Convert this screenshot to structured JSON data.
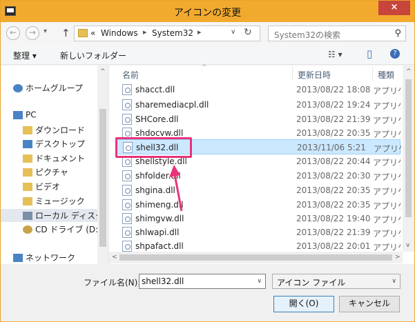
{
  "window": {
    "title": "アイコンの変更",
    "close_glyph": "×"
  },
  "nav": {
    "back_glyph": "←",
    "forward_glyph": "→",
    "history_glyph": "▾",
    "up_glyph": "↑",
    "crumbs": [
      "«",
      "Windows",
      "▸",
      "System32",
      "▸"
    ],
    "dropdown_glyph": "∨",
    "refresh_glyph": "↻",
    "search_placeholder": "System32の検索",
    "search_glyph": "⚲"
  },
  "toolbar": {
    "organize_label": "整理 ▾",
    "new_folder_label": "新しいフォルダー",
    "view_glyph": "☷ ▾",
    "pane_glyph": "▯",
    "help_glyph": "?"
  },
  "sidebar": {
    "items": [
      {
        "label": "ホームグループ",
        "icon": "homegroup-icon",
        "color": "#4a83c5"
      },
      {
        "label": "PC",
        "icon": "pc-icon",
        "color": "#4a83c5"
      },
      {
        "label": "ダウンロード",
        "icon": "downloads-folder-icon",
        "color": "#e6bf57"
      },
      {
        "label": "デスクトップ",
        "icon": "desktop-folder-icon",
        "color": "#4a83c5"
      },
      {
        "label": "ドキュメント",
        "icon": "documents-folder-icon",
        "color": "#e6bf57"
      },
      {
        "label": "ピクチャ",
        "icon": "pictures-folder-icon",
        "color": "#e6bf57"
      },
      {
        "label": "ビデオ",
        "icon": "videos-folder-icon",
        "color": "#e6bf57"
      },
      {
        "label": "ミュージック",
        "icon": "music-folder-icon",
        "color": "#e6bf57"
      },
      {
        "label": "ローカル ディスク (C",
        "icon": "local-disk-icon",
        "color": "#7a8fa8"
      },
      {
        "label": "CD ドライブ (D:) \\",
        "icon": "cd-drive-icon",
        "color": "#c9a34a"
      },
      {
        "label": "ネットワーク",
        "icon": "network-icon",
        "color": "#4a83c5"
      }
    ]
  },
  "columns": {
    "name": "名前",
    "date": "更新日時",
    "type": "種類",
    "sort_glyph": "^"
  },
  "files": [
    {
      "name": "shacct.dll",
      "date": "2013/08/22 18:08",
      "type": "アプリケ"
    },
    {
      "name": "sharemediacpl.dll",
      "date": "2013/08/22 19:24",
      "type": "アプリケ"
    },
    {
      "name": "SHCore.dll",
      "date": "2013/08/22 21:39",
      "type": "アプリケ"
    },
    {
      "name": "shdocvw.dll",
      "date": "2013/08/22 20:35",
      "type": "アプリケ"
    },
    {
      "name": "shell32.dll",
      "date": "2013/11/06 5:21",
      "type": "アプリケ"
    },
    {
      "name": "shellstyle.dll",
      "date": "2013/08/22 20:44",
      "type": "アプリケ"
    },
    {
      "name": "shfolder.dll",
      "date": "2013/08/22 20:30",
      "type": "アプリケ"
    },
    {
      "name": "shgina.dll",
      "date": "2013/08/22 20:35",
      "type": "アプリケ"
    },
    {
      "name": "shimeng.dll",
      "date": "2013/08/22 20:35",
      "type": "アプリケ"
    },
    {
      "name": "shimgvw.dll",
      "date": "2013/08/22 19:40",
      "type": "アプリケ"
    },
    {
      "name": "shlwapi.dll",
      "date": "2013/08/22 21:39",
      "type": "アプリケ"
    },
    {
      "name": "shpafact.dll",
      "date": "2013/08/22 20:01",
      "type": "アプリケ"
    }
  ],
  "scroll_glyphs": {
    "up": "^",
    "down": "v",
    "left": "<",
    "right": ">"
  },
  "bottom": {
    "filename_label": "ファイル名(N):",
    "filename_value": "shell32.dll",
    "filetype_value": "アイコン ファイル",
    "dropdown_glyph": "∨",
    "open_label": "開く(O)",
    "cancel_label": "キャンセル"
  },
  "accent": {
    "highlight": "#e8337a",
    "selection": "#cce8ff",
    "titlebar": "#f2aa2e"
  }
}
